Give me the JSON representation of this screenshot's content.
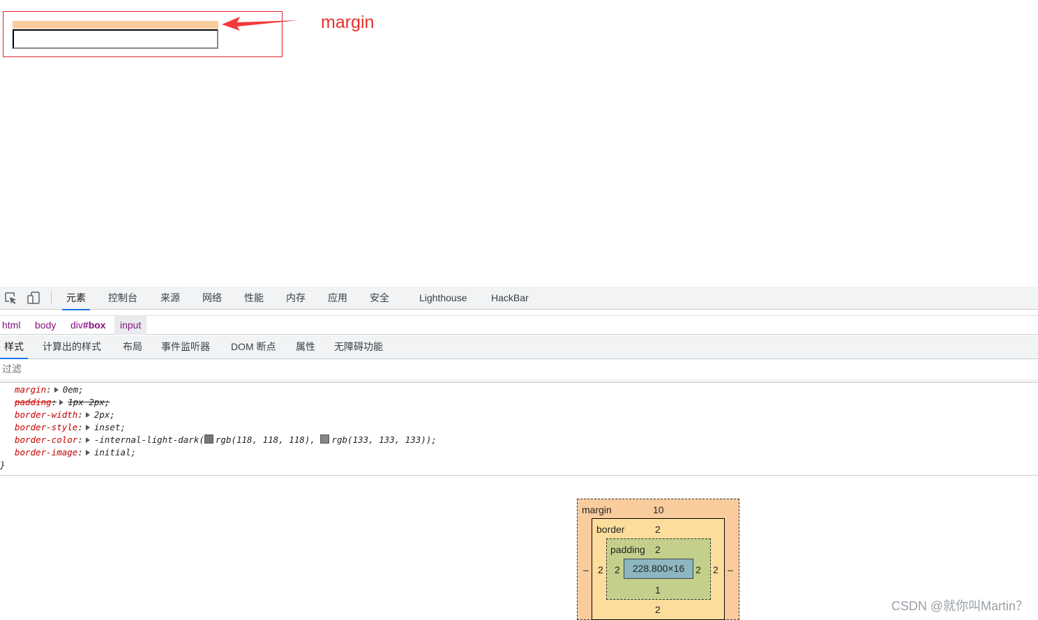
{
  "annotation": {
    "label": "margin"
  },
  "devtools": {
    "tabs": [
      "元素",
      "控制台",
      "来源",
      "网络",
      "性能",
      "内存",
      "应用",
      "安全",
      "Lighthouse",
      "HackBar"
    ],
    "breadcrumbs": {
      "html": "html",
      "body": "body",
      "div_tag": "div",
      "div_id": "#box",
      "input": "input"
    },
    "subtabs": [
      "样式",
      "计算出的样式",
      "布局",
      "事件监听器",
      "DOM 断点",
      "属性",
      "无障碍功能"
    ],
    "filter_placeholder": "过滤",
    "declarations": [
      {
        "prop": "margin",
        "value": "0em;"
      },
      {
        "prop": "padding",
        "value": "1px 2px;"
      },
      {
        "prop": "border-width",
        "value": "2px;"
      },
      {
        "prop": "border-style",
        "value": "inset;"
      },
      {
        "prop": "border-color",
        "value_prefix": "-internal-light-dark(",
        "color1": "rgb(118, 118, 118),",
        "color2": "rgb(133, 133, 133));"
      },
      {
        "prop": "border-image",
        "value": "initial;"
      }
    ],
    "closing_brace": "}",
    "box_model": {
      "margin_label": "margin",
      "margin_top": "10",
      "margin_left": "–",
      "margin_right": "–",
      "border_label": "border",
      "border_top": "2",
      "border_left": "2",
      "border_right": "2",
      "border_bottom": "2",
      "padding_label": "padding",
      "padding_top": "2",
      "padding_left": "2",
      "padding_right": "2",
      "padding_bottom": "1",
      "content": "228.800×16"
    }
  },
  "watermark": "CSDN @就你叫Martin？"
}
